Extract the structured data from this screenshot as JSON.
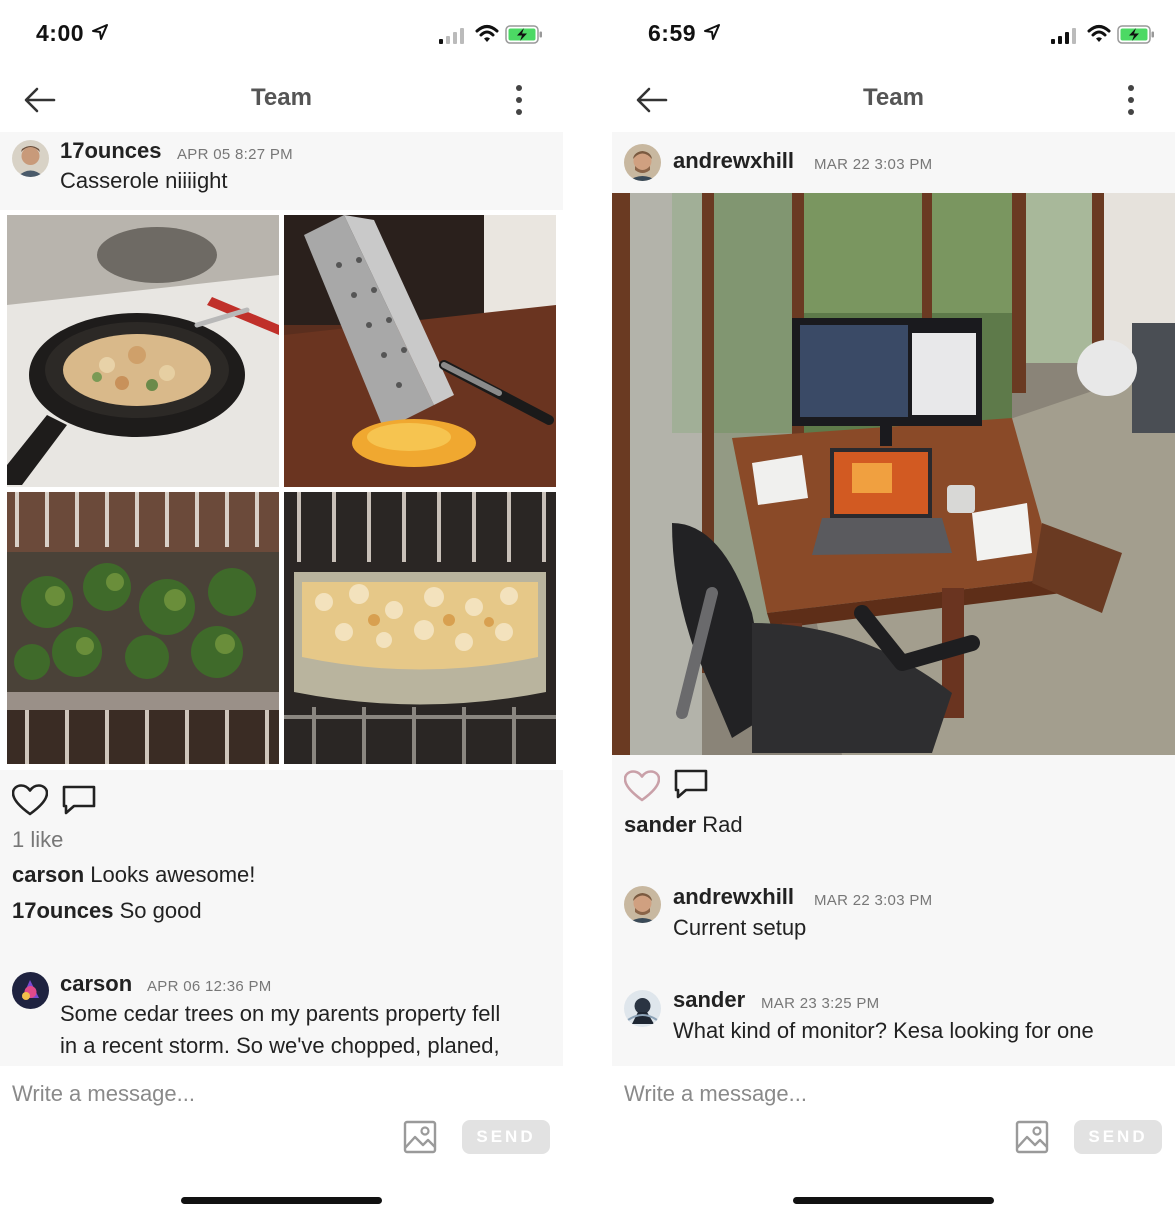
{
  "left_screen": {
    "status": {
      "time": "4:00"
    },
    "header": {
      "title": "Team"
    },
    "post": {
      "username": "17ounces",
      "timestamp": "APR 05 8:27 PM",
      "text": "Casserole niiiight",
      "likes": "1 like",
      "comments": [
        {
          "user": "carson",
          "text": "Looks awesome!"
        },
        {
          "user": "17ounces",
          "text": "So good"
        }
      ]
    },
    "next_post": {
      "username": "carson",
      "timestamp": "APR 06 12:36 PM",
      "text_line1": "Some cedar trees on my parents property fell",
      "text_line2": "in a recent storm. So we've chopped, planed,"
    },
    "composer": {
      "placeholder": "Write a message...",
      "send_label": "SEND"
    }
  },
  "right_screen": {
    "status": {
      "time": "6:59"
    },
    "header": {
      "title": "Team"
    },
    "post": {
      "username": "andrewxhill",
      "timestamp": "MAR 22 3:03 PM",
      "comments": [
        {
          "user": "sander",
          "text": "Rad"
        }
      ]
    },
    "messages": [
      {
        "username": "andrewxhill",
        "timestamp": "MAR 22 3:03 PM",
        "text": "Current setup"
      },
      {
        "username": "sander",
        "timestamp": "MAR 23 3:25 PM",
        "text": "What kind of monitor? Kesa looking for one"
      }
    ],
    "composer": {
      "placeholder": "Write a message...",
      "send_label": "SEND"
    }
  },
  "colors": {
    "feed_background": "#f7f7f7",
    "heart_liked_outline": "#c9a0a8",
    "send_button_disabled": "#e2e2e2",
    "battery_green": "#4cd964"
  },
  "icons": [
    "location-arrow-icon",
    "signal-icon",
    "wifi-icon",
    "battery-charging-icon",
    "back-arrow-icon",
    "more-vertical-icon",
    "heart-icon",
    "comment-icon",
    "image-icon"
  ]
}
